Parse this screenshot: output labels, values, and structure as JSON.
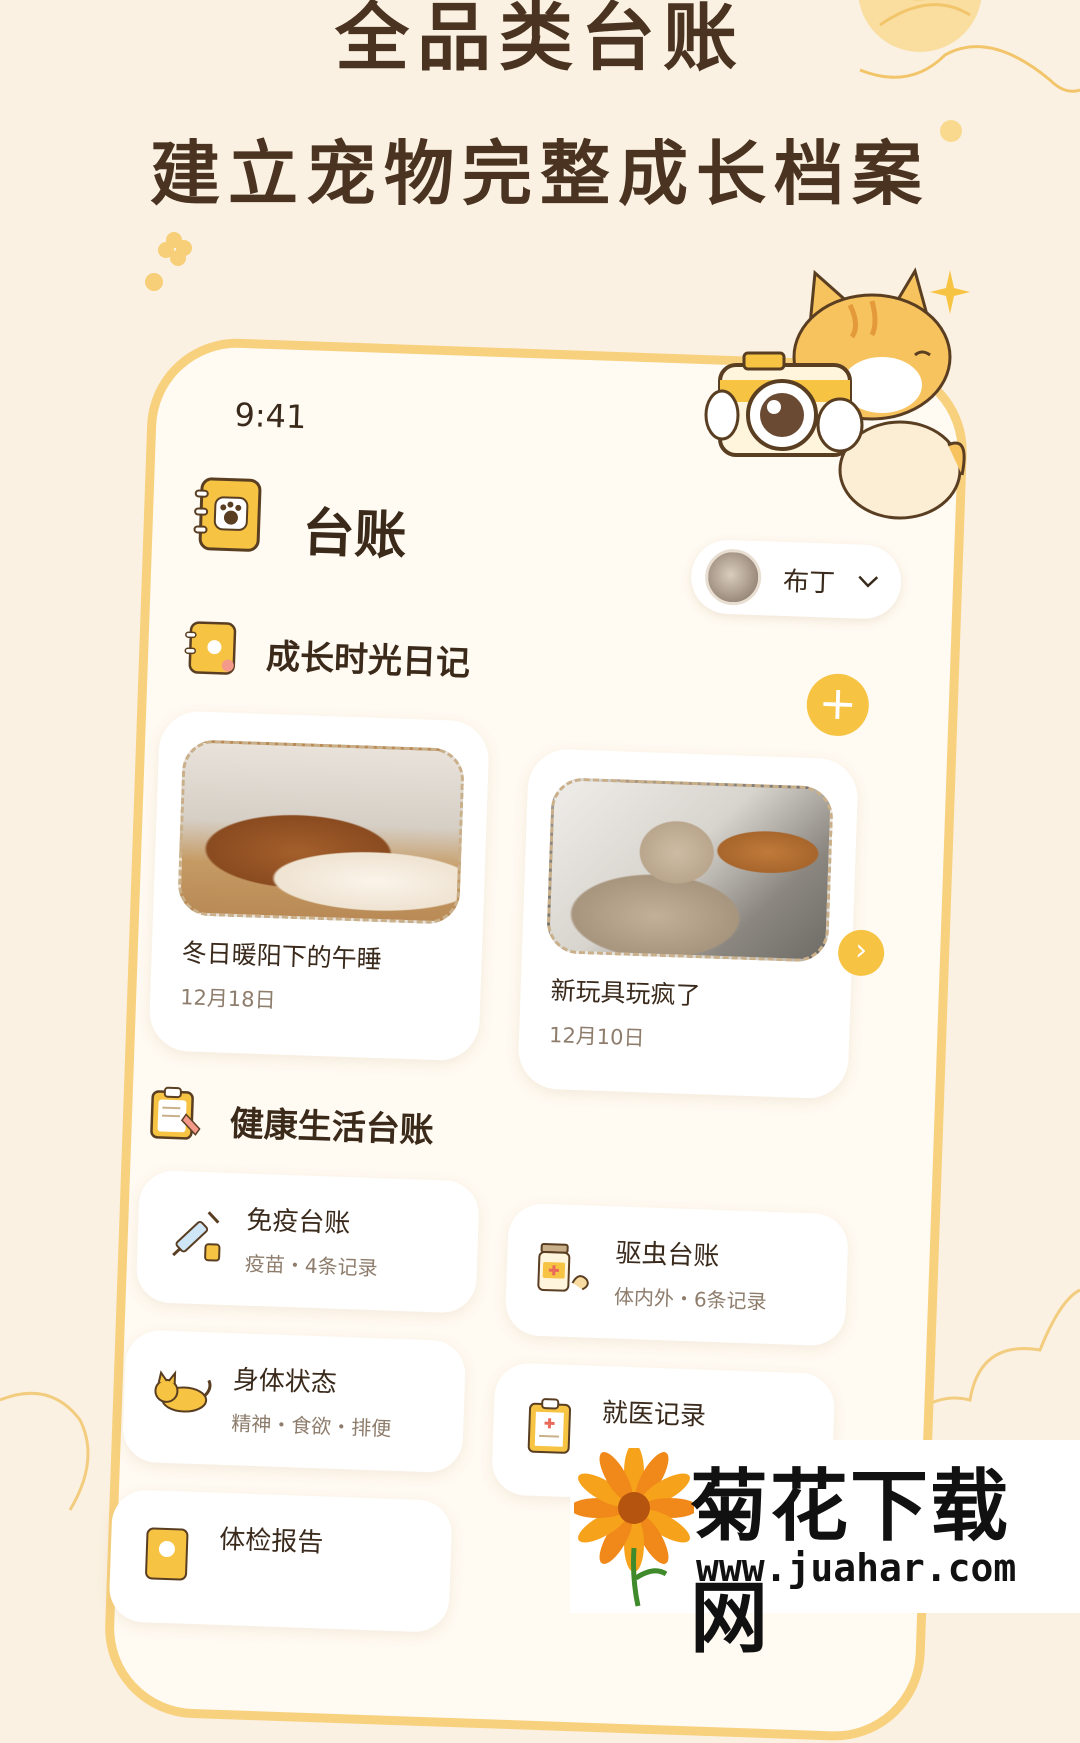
{
  "headline": {
    "line1": "全品类台账",
    "line2": "建立宠物完整成长档案"
  },
  "status": {
    "time": "9:41"
  },
  "page": {
    "title": "台账"
  },
  "pet_selector": {
    "name": "布丁"
  },
  "diary": {
    "section_title": "成长时光日记",
    "entries": [
      {
        "title": "冬日暖阳下的午睡",
        "date": "12月18日"
      },
      {
        "title": "新玩具玩疯了",
        "date": "12月10日"
      }
    ]
  },
  "health": {
    "section_title": "健康生活台账",
    "items": [
      {
        "title": "免疫台账",
        "subtitle": "疫苗・4条记录"
      },
      {
        "title": "驱虫台账",
        "subtitle": "体内外・6条记录"
      },
      {
        "title": "身体状态",
        "subtitle": "精神・食欲・排便"
      },
      {
        "title": "就医记录",
        "subtitle": ""
      },
      {
        "title": "体检报告",
        "subtitle": ""
      }
    ]
  },
  "watermark": {
    "title": "菊花下载网",
    "url": "www.juahar.com"
  },
  "colors": {
    "background": "#fbf1e2",
    "accent": "#f6c343",
    "frame": "#f8d17e",
    "text": "#3b2a1a"
  }
}
